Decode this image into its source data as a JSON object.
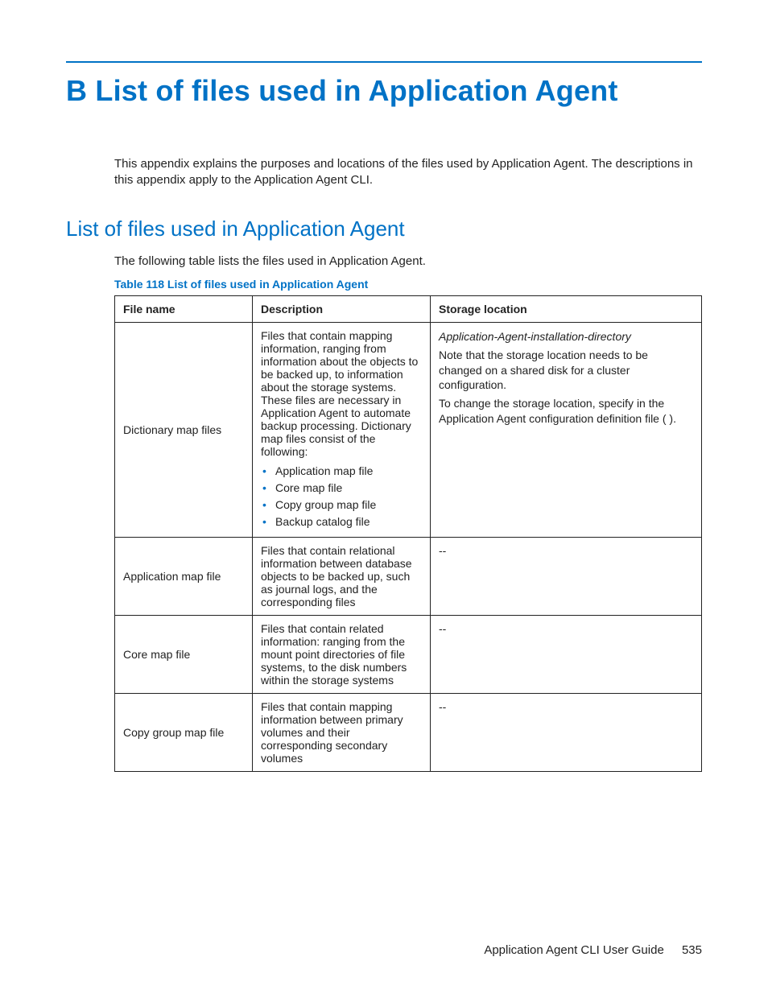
{
  "page": {
    "title": "B List of files used in Application Agent",
    "intro": "This appendix explains the purposes and locations of the files used by Application Agent. The descriptions in this appendix apply to the Application Agent CLI."
  },
  "section": {
    "heading": "List of files used in Application Agent",
    "subtext": "The following table lists the files used in Application Agent.",
    "caption": "Table 118 List of files used in Application Agent"
  },
  "table": {
    "headers": {
      "name": "File name",
      "desc": "Description",
      "loc": "Storage location"
    },
    "rows": [
      {
        "name": "Dictionary map files",
        "desc_lead": "Files that contain mapping information, ranging from information about the objects to be backed up, to information about the storage systems. These files are necessary in Application Agent to automate backup processing. Dictionary map files consist of the following:",
        "bullets": [
          "Application map file",
          "Core map file",
          "Copy group map file",
          "Backup catalog file"
        ],
        "loc_italic": "Application-Agent-installation-directory",
        "loc_p1": "Note that the storage location needs to be changed on a shared disk for a cluster configuration.",
        "loc_p2a": "To change the storage location, specify ",
        "loc_p2b": " in the Application Agent configuration definition file (",
        "loc_p2c": ")."
      },
      {
        "name": "Application map file",
        "desc": "Files that contain relational information between database objects to be backed up, such as journal logs, and the corresponding files",
        "loc": "--"
      },
      {
        "name": "Core map file",
        "desc": "Files that contain related information: ranging from the mount point directories of file systems, to the disk numbers within the storage systems",
        "loc": "--"
      },
      {
        "name": "Copy group map file",
        "desc": "Files that contain mapping information between primary volumes and their corresponding secondary volumes",
        "loc": "--"
      }
    ]
  },
  "footer": {
    "doc": "Application Agent CLI User Guide",
    "page": "535"
  }
}
